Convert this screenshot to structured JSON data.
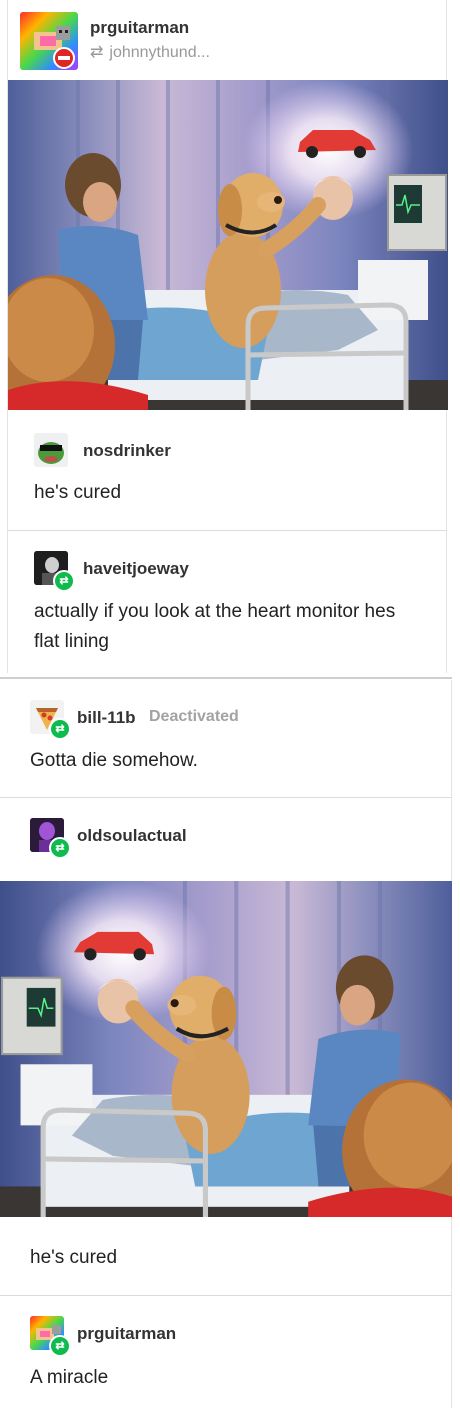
{
  "posts": [
    {
      "username": "prguitarman",
      "reblog_from": "johnnythund..."
    },
    {
      "username": "nosdrinker",
      "text": "he's cured"
    },
    {
      "username": "haveitjoeway",
      "text": "actually if you look at the heart monitor hes flat lining"
    },
    {
      "username": "bill-11b",
      "status": "Deactivated",
      "text": "Gotta die somehow."
    },
    {
      "username": "oldsoulactual",
      "text": "he's cured"
    },
    {
      "username": "prguitarman",
      "text": "A miracle"
    }
  ],
  "icons": {
    "reblog": "reblog-icon",
    "badge": "reblog-badge-icon"
  },
  "colors": {
    "badge": "#0dbb4e",
    "meta": "#999999",
    "divider": "#dcdcdc"
  }
}
